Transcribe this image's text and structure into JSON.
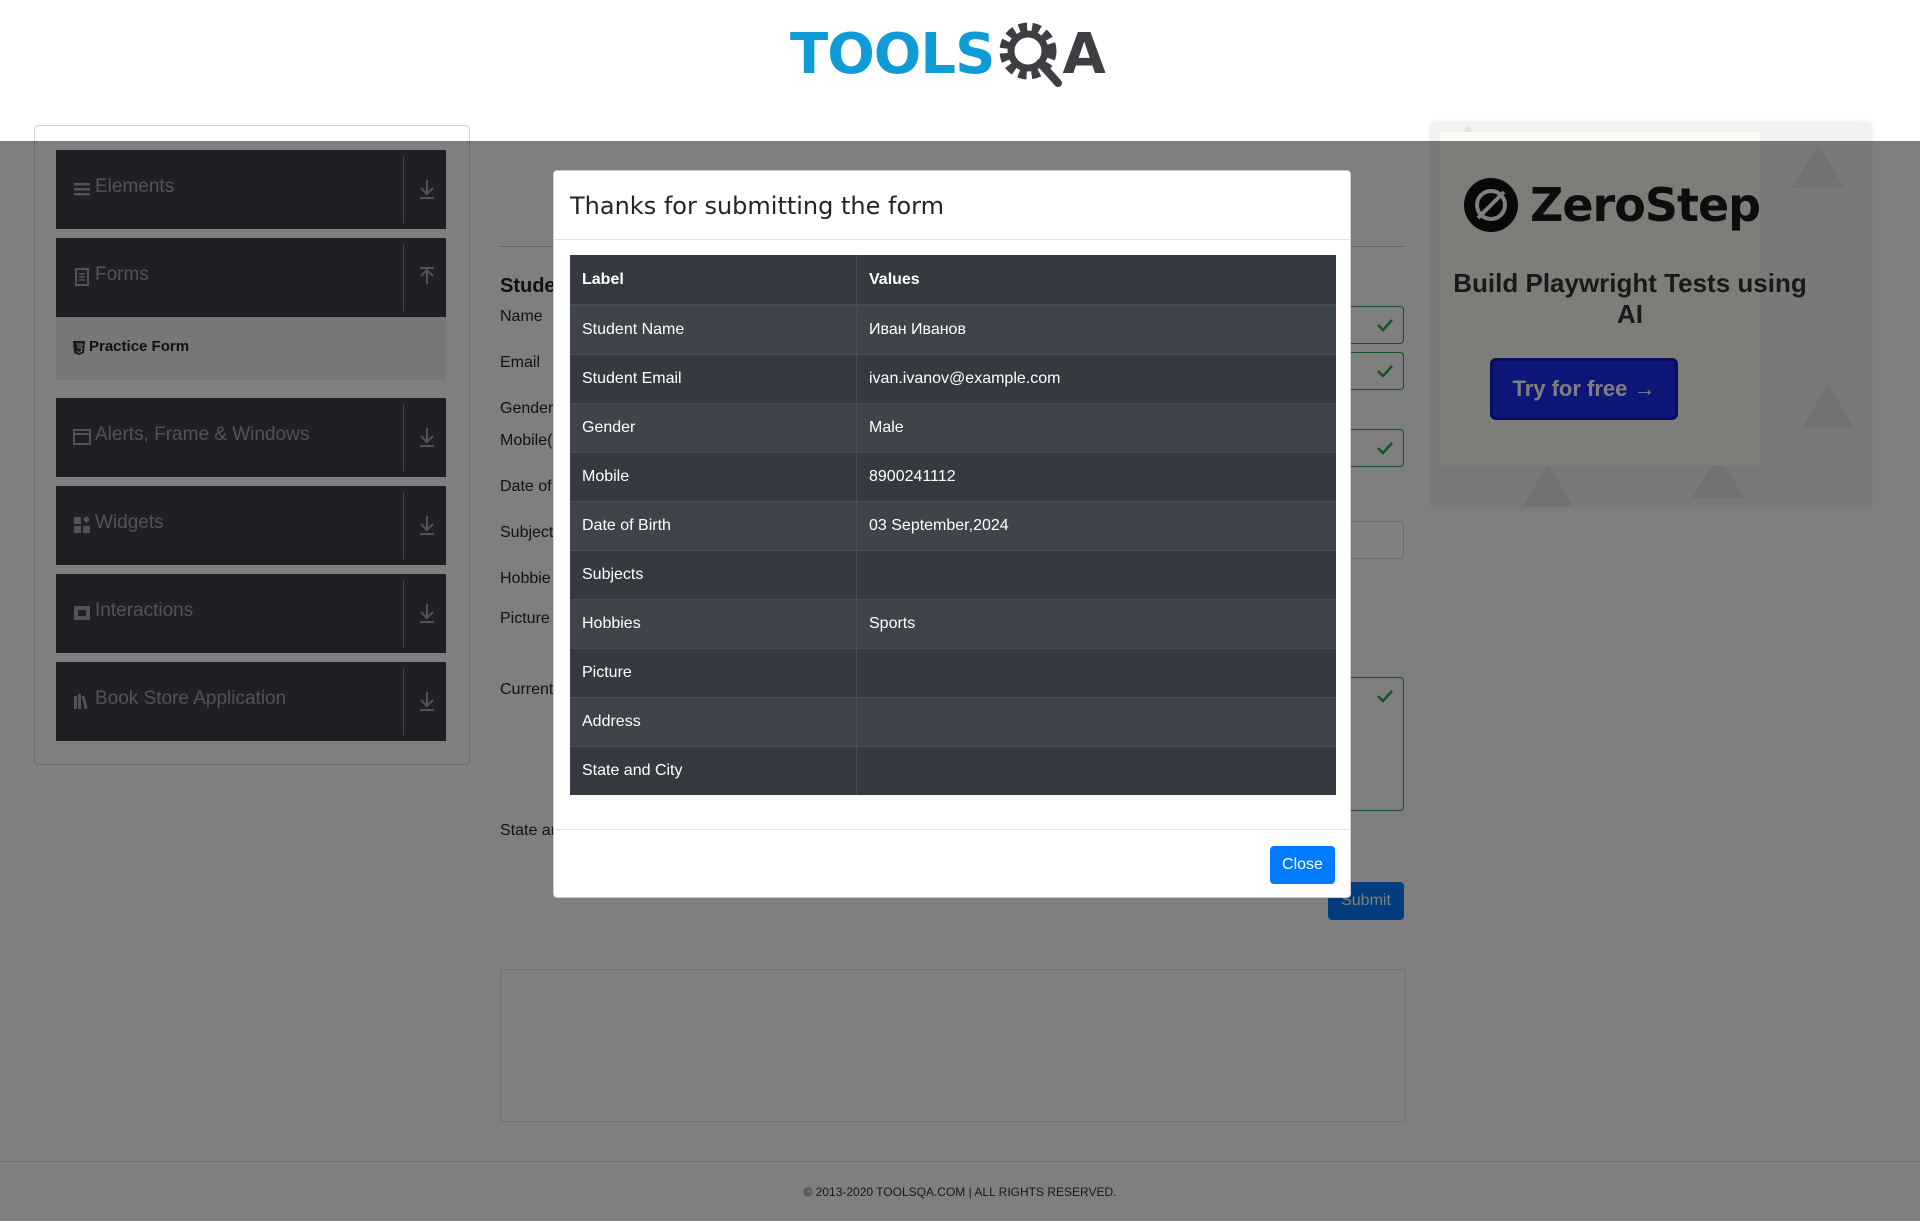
{
  "header": {
    "logo_text_tools": "TOOLS",
    "logo_text_a": "A",
    "logo_alt": "TOOLSQA"
  },
  "sidebar": {
    "groups": [
      {
        "label": "Elements",
        "icon": "hamburger-icon",
        "arrow": "download-arrow-icon"
      },
      {
        "label": "Forms",
        "icon": "document-icon",
        "arrow": "upload-arrow-icon"
      },
      {
        "label": "Alerts, Frame & Windows",
        "icon": "window-icon",
        "arrow": "download-arrow-icon"
      },
      {
        "label": "Widgets",
        "icon": "widgets-icon",
        "arrow": "download-arrow-icon"
      },
      {
        "label": "Interactions",
        "icon": "interactions-icon",
        "arrow": "download-arrow-icon"
      },
      {
        "label": "Book Store Application",
        "icon": "books-icon",
        "arrow": "download-arrow-icon"
      }
    ],
    "active_item": "Practice Form"
  },
  "form": {
    "title": "Stude",
    "labels": {
      "name": "Name",
      "email": "Email",
      "gender": "Gender",
      "mobile": "Mobile(",
      "dob": "Date of",
      "subjects": "Subject",
      "hobbies": "Hobbie",
      "picture": "Picture",
      "address": "Current",
      "state": "State ar"
    },
    "submit_label": "Submit"
  },
  "ad": {
    "brand": "ZeroStep",
    "headline": "Build Playwright Tests using AI",
    "button": "Try for free →"
  },
  "modal": {
    "title": "Thanks for submitting the form",
    "columns": [
      "Label",
      "Values"
    ],
    "rows": [
      {
        "label": "Student Name",
        "value": "Иван Иванов"
      },
      {
        "label": "Student Email",
        "value": "ivan.ivanov@example.com"
      },
      {
        "label": "Gender",
        "value": "Male"
      },
      {
        "label": "Mobile",
        "value": "8900241112"
      },
      {
        "label": "Date of Birth",
        "value": "03 September,2024"
      },
      {
        "label": "Subjects",
        "value": ""
      },
      {
        "label": "Hobbies",
        "value": "Sports"
      },
      {
        "label": "Picture",
        "value": ""
      },
      {
        "label": "Address",
        "value": ""
      },
      {
        "label": "State and City",
        "value": ""
      }
    ],
    "close_label": "Close"
  },
  "footer": {
    "text": "© 2013-2020 TOOLSQA.COM | ALL RIGHTS RESERVED."
  },
  "colors": {
    "accent": "#007bff",
    "table_bg": "#343a40",
    "sidebar_group": "#3e4149",
    "valid": "#28a745",
    "logo_blue": "#0f9bd6"
  }
}
